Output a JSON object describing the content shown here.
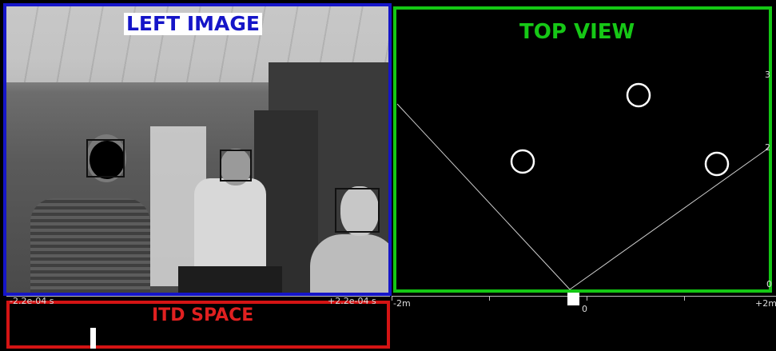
{
  "left_panel": {
    "title": "LEFT IMAGE"
  },
  "top_view": {
    "title": "TOP VIEW",
    "y_ticks": [
      "3",
      "2",
      "0"
    ]
  },
  "itd_space": {
    "title": "ITD SPACE",
    "left_label": "-2.2e-04 s",
    "right_label": "+2.2e-04 s"
  },
  "bottom_axis": {
    "left_label": "-2m",
    "center_label": "0",
    "right_label": "+2m"
  },
  "colors": {
    "left_border": "#1515c8",
    "top_view_border": "#14c814",
    "itd_border": "#d41414"
  }
}
